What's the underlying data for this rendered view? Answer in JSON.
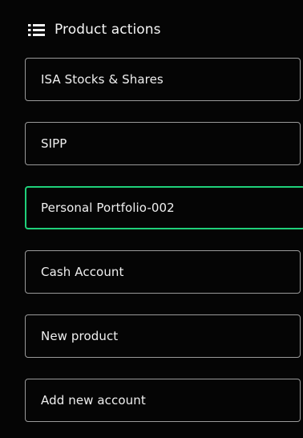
{
  "header": {
    "icon": "list-menu-icon",
    "title": "Product actions"
  },
  "items": [
    {
      "label": "ISA Stocks & Shares",
      "selected": false
    },
    {
      "label": "SIPP",
      "selected": false
    },
    {
      "label": "Personal Portfolio-002",
      "selected": true
    },
    {
      "label": "Cash Account",
      "selected": false
    },
    {
      "label": "New product",
      "selected": false
    },
    {
      "label": "Add new account",
      "selected": false
    }
  ],
  "colors": {
    "background": "#050505",
    "border": "#9a9a9a",
    "selected_border": "#1fd07a",
    "text": "#f0f0f0"
  }
}
